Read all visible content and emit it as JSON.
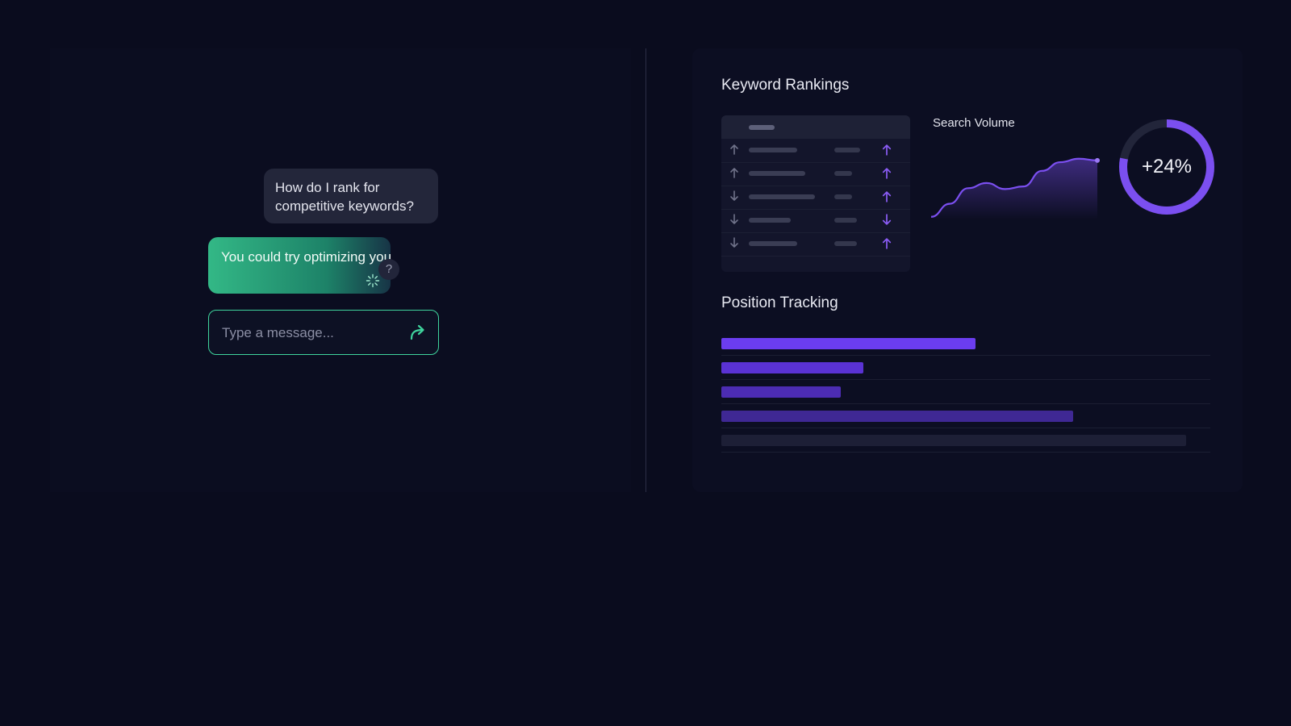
{
  "chat": {
    "user_message": "How do I rank for competitive keywords?",
    "ai_message": "You could try optimizing your content... maybe?",
    "help_glyph": "?",
    "input_placeholder": "Type a message...",
    "send_icon": "send-arrow-icon",
    "loading_icon": "spinner-icon"
  },
  "keyword_rankings": {
    "title": "Keyword Rankings",
    "rows": [
      {
        "left_trend": "up",
        "right_trend": "up"
      },
      {
        "left_trend": "up",
        "right_trend": "up"
      },
      {
        "left_trend": "down",
        "right_trend": "up"
      },
      {
        "left_trend": "down",
        "right_trend": "down"
      },
      {
        "left_trend": "down",
        "right_trend": "up"
      }
    ]
  },
  "search_volume": {
    "label": "Search Volume",
    "chart_data": {
      "type": "area",
      "values": [
        3,
        18,
        36,
        42,
        35,
        38,
        56,
        66,
        70,
        68
      ],
      "ylim": [
        0,
        80
      ],
      "color": "#7b4ff0"
    }
  },
  "growth": {
    "value_label": "+24%",
    "fraction": 0.78,
    "color": "#7b4ff0",
    "track_color": "#22253a"
  },
  "position_tracking": {
    "title": "Position Tracking",
    "bars": [
      {
        "fraction": 0.52,
        "color": "#6b3df0"
      },
      {
        "fraction": 0.29,
        "color": "#5a32d4"
      },
      {
        "fraction": 0.245,
        "color": "#4c2cb3"
      },
      {
        "fraction": 0.72,
        "color": "#3f2894"
      },
      {
        "fraction": 0.95,
        "color": "#1d1f36"
      }
    ]
  },
  "colors": {
    "accent_green": "#3fd49d",
    "accent_purple": "#7b4ff0",
    "background": "#0a0c1e"
  }
}
